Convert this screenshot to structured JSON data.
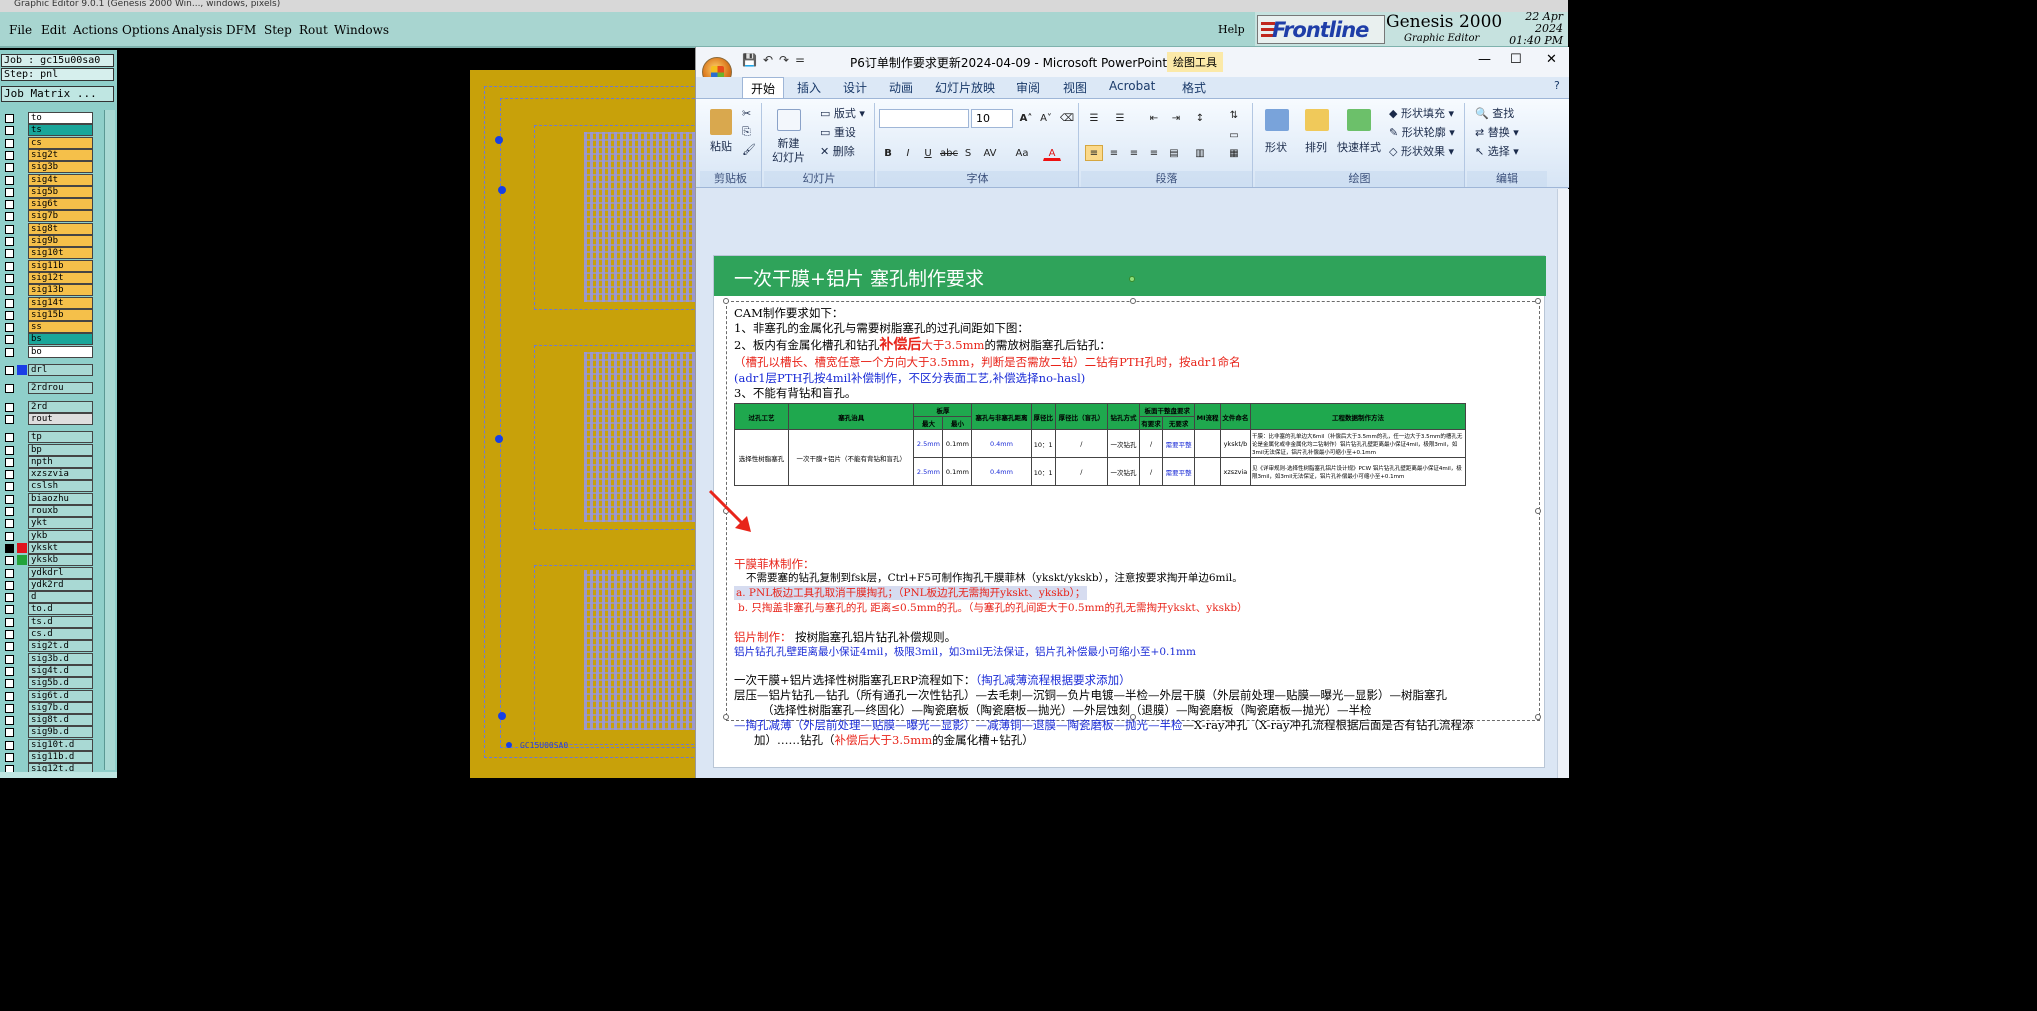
{
  "genesis": {
    "title": "Graphic Editor 9.0.1 (Genesis 2000 Win..., windows, pixels)",
    "menu": [
      "File",
      "Edit",
      "Actions",
      "Options",
      "Analysis",
      "DFM",
      "Step",
      "Rout",
      "Windows"
    ],
    "help": "Help",
    "logo": "Frontline",
    "product": "Genesis 2000",
    "product_sub": "Graphic Editor",
    "date": "22 Apr 2024",
    "time": "01:40 PM",
    "job": "Job : gc15u00sa0",
    "step": "Step: pnl",
    "job_matrix": "Job Matrix ...",
    "board_label": "GC15U00SA0",
    "layers": [
      {
        "name": "to",
        "color": "#ffffff"
      },
      {
        "name": "ts",
        "color": "#1aa69a"
      },
      {
        "name": "cs",
        "color": "#f5c04a"
      },
      {
        "name": "sig2t",
        "color": "#f5c04a"
      },
      {
        "name": "sig3b",
        "color": "#f5c04a"
      },
      {
        "name": "sig4t",
        "color": "#f5c04a"
      },
      {
        "name": "sig5b",
        "color": "#f5c04a"
      },
      {
        "name": "sig6t",
        "color": "#f5c04a"
      },
      {
        "name": "sig7b",
        "color": "#f5c04a"
      },
      {
        "name": "sig8t",
        "color": "#f5c04a"
      },
      {
        "name": "sig9b",
        "color": "#f5c04a"
      },
      {
        "name": "sig10t",
        "color": "#f5c04a"
      },
      {
        "name": "sig11b",
        "color": "#f5c04a"
      },
      {
        "name": "sig12t",
        "color": "#f5c04a"
      },
      {
        "name": "sig13b",
        "color": "#f5c04a"
      },
      {
        "name": "sig14t",
        "color": "#f5c04a"
      },
      {
        "name": "sig15b",
        "color": "#f5c04a"
      },
      {
        "name": "ss",
        "color": "#f5c04a"
      },
      {
        "name": "bs",
        "color": "#1aa69a"
      },
      {
        "name": "bo",
        "color": "#ffffff"
      },
      {
        "name": "drl",
        "color": "#a9d9d4",
        "swatch": "#1a3de6"
      },
      {
        "name": "2rdrou",
        "color": "#a9d9d4"
      },
      {
        "name": "2rd",
        "color": "#a9d9d4"
      },
      {
        "name": "rout",
        "color": "#dedede"
      },
      {
        "name": "tp",
        "color": "#a9d9d4"
      },
      {
        "name": "bp",
        "color": "#a9d9d4"
      },
      {
        "name": "npth",
        "color": "#a9d9d4"
      },
      {
        "name": "xzszvia",
        "color": "#a9d9d4"
      },
      {
        "name": "cslsh",
        "color": "#a9d9d4"
      },
      {
        "name": "biaozhu",
        "color": "#a9d9d4"
      },
      {
        "name": "rouxb",
        "color": "#a9d9d4"
      },
      {
        "name": "ykt",
        "color": "#a9d9d4"
      },
      {
        "name": "ykb",
        "color": "#a9d9d4"
      },
      {
        "name": "ykskt",
        "color": "#a9d9d4",
        "swatch": "#e0141e",
        "checked": true
      },
      {
        "name": "ykskb",
        "color": "#a9d9d4",
        "swatch": "#22a33a"
      },
      {
        "name": "ydkdrl",
        "color": "#a9d9d4"
      },
      {
        "name": "ydk2rd",
        "color": "#a9d9d4"
      },
      {
        "name": "d",
        "color": "#a9d9d4"
      },
      {
        "name": "to.d",
        "color": "#a9d9d4"
      },
      {
        "name": "ts.d",
        "color": "#a9d9d4"
      },
      {
        "name": "cs.d",
        "color": "#a9d9d4"
      },
      {
        "name": "sig2t.d",
        "color": "#a9d9d4"
      },
      {
        "name": "sig3b.d",
        "color": "#a9d9d4"
      },
      {
        "name": "sig4t.d",
        "color": "#a9d9d4"
      },
      {
        "name": "sig5b.d",
        "color": "#a9d9d4"
      },
      {
        "name": "sig6t.d",
        "color": "#a9d9d4"
      },
      {
        "name": "sig7b.d",
        "color": "#a9d9d4"
      },
      {
        "name": "sig8t.d",
        "color": "#a9d9d4"
      },
      {
        "name": "sig9b.d",
        "color": "#a9d9d4"
      },
      {
        "name": "sig10t.d",
        "color": "#a9d9d4"
      },
      {
        "name": "sig11b.d",
        "color": "#a9d9d4"
      },
      {
        "name": "sig12t.d",
        "color": "#a9d9d4"
      }
    ]
  },
  "ppt": {
    "title": "P6订单制作要求更新2024-04-09 - Microsoft PowerPoint",
    "context_tab": "绘图工具",
    "tabs": [
      "开始",
      "插入",
      "设计",
      "动画",
      "幻灯片放映",
      "审阅",
      "视图",
      "Acrobat",
      "格式"
    ],
    "groups": {
      "clipboard": "剪贴板",
      "paste": "粘贴",
      "slides": "幻灯片",
      "new_slide": "新建\n幻灯片",
      "layout": "版式",
      "reset": "重设",
      "delete": "删除",
      "font": "字体",
      "font_size": "10",
      "paragraph": "段落",
      "drawing": "绘图",
      "shape": "形状",
      "arrange": "排列",
      "quick_styles": "快速样式",
      "fill": "形状填充",
      "outline": "形状轮廓",
      "effects": "形状效果",
      "editing": "编辑",
      "find": "查找",
      "replace": "替换",
      "select": "选择"
    },
    "slide": {
      "title": "一次干膜+铝片 塞孔制作要求",
      "lines": {
        "l1": "CAM制作要求如下：",
        "l2": "1、非塞孔的金属化孔与需要树脂塞孔的过孔间距如下图：",
        "l3a": "2、板内有金属化槽孔和钻孔",
        "l3b": "补偿后",
        "l3c": "大于3.5mm",
        "l3d": "的需放树脂塞孔后钻孔：",
        "l4": "（槽孔以槽长、槽宽任意一个方向大于3.5mm，判断是否需放二钻）二钻有PTH孔时，按adr1命名",
        "l5": "(adr1层PTH孔按4mil补偿制作，不区分表面工艺,补偿选择no-hasl)",
        "l6": "3、不能有背钻和盲孔。",
        "l7": "干膜菲林制作：",
        "l8": "不需要塞的钻孔复制到fsk层，Ctrl+F5可制作掏孔干膜菲林（ykskt/ykskb），注意按要求掏开单边6mil。",
        "l9": "a. PNL板边工具孔取消干膜掏孔；（PNL板边孔无需掏开ykskt、ykskb）；",
        "l10": "b. 只掏盖非塞孔与塞孔的孔 距离≤0.5mm的孔。（与塞孔的孔间距大于0.5mm的孔无需掏开ykskt、ykskb）",
        "l11a": "铝片制作：",
        "l11b": "按树脂塞孔铝片钻孔补偿规则。",
        "l12": "铝片钻孔孔壁距离最小保证4mil，极限3mil，如3mil无法保证，铝片孔补偿最小可缩小至+0.1mm",
        "l13a": "一次干膜+铝片选择性树脂塞孔ERP流程如下：",
        "l13b": "（掏孔减薄流程根据要求添加）",
        "l14": "层压—铝片钻孔—钻孔（所有通孔一次性钻孔）—去毛刺—沉铜—负片电镀—半检—外层干膜（外层前处理—贴膜—曝光—显影）—树脂塞孔",
        "l15": "（选择性树脂塞孔—终固化）—陶瓷磨板（陶瓷磨板—抛光）—外层蚀刻（退膜）—陶瓷磨板（陶瓷磨板—抛光）—半检",
        "l16a": "—掏孔减薄（外层前处理—贴膜—曝光—显影）—减薄铜—退膜—陶瓷磨板—抛光—半检",
        "l16b": "—X-ray冲孔（X-ray冲孔流程根据后面是否有钻孔流程添",
        "l17a": "加）……钻孔（",
        "l17b": "补偿后大于3.5mm",
        "l17c": "的金属化槽+钻孔）"
      },
      "table": {
        "headers": [
          "过孔工艺",
          "塞孔治具",
          "板厚",
          "塞孔与非塞孔距离",
          "厚径比",
          "厚径比（盲孔）",
          "钻孔方式",
          "板面干整盘要求",
          "MI流程",
          "文件命名",
          "工程数据制作方法"
        ],
        "sub": [
          "最大",
          "最小",
          "有要求",
          "无要求"
        ],
        "rows": [
          [
            "选择性树脂塞孔",
            "一次干膜+铝片（不能有背钻和盲孔）",
            "2.5mm",
            "0.1mm",
            "0.4mm",
            "10：1",
            "/",
            "一次钻孔",
            "/",
            "需要平整",
            "",
            "ykskt/b",
            "干膜：比非塞的孔单边大6mil（补偿后大于3.5mm的孔，任一边大于3.5mm的槽孔无论是金属化或非金属化均二钻制作）铝片钻孔孔壁距离最小保证4mil，极限3mil，如3mil无法保证，铝片孔补偿最小可缩小至+0.1mm"
          ],
          [
            "",
            "",
            "2.5mm",
            "0.1mm",
            "0.4mm",
            "10：1",
            "/",
            "一次钻孔",
            "/",
            "需要平整",
            "",
            "xzszvia",
            "见《详审规则-选择性树脂塞孔铝片设计规》PCW 铝片钻孔孔壁距离最小保证4mil，极限3mil，如3mil无法保证，铝片孔补偿最小可缩小至+0.1mm"
          ]
        ]
      }
    }
  }
}
